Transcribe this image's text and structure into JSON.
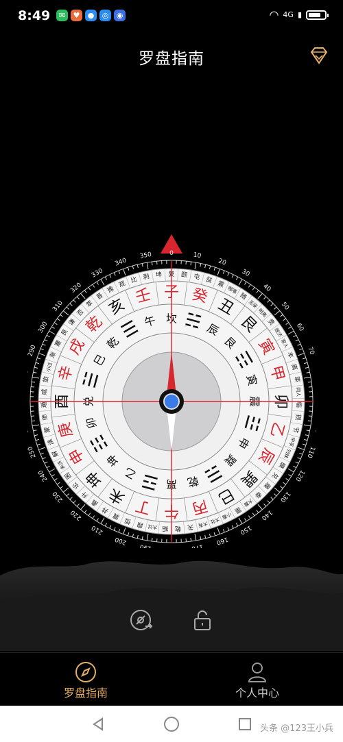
{
  "status": {
    "time": "8:49",
    "network": "4G"
  },
  "header": {
    "title": "罗盘指南"
  },
  "compass": {
    "heading_deg": 0,
    "degree_labels": [
      "0",
      "10",
      "20",
      "30",
      "40",
      "50",
      "60",
      "70",
      "80",
      "90",
      "100",
      "110",
      "120",
      "130",
      "140",
      "150",
      "160",
      "170",
      "180",
      "190",
      "200",
      "210",
      "220",
      "230",
      "240",
      "250",
      "260",
      "270",
      "280",
      "290",
      "300",
      "310",
      "320",
      "330",
      "340",
      "350"
    ],
    "mountains": [
      "子",
      "癸",
      "丑",
      "艮",
      "寅",
      "甲",
      "卯",
      "乙",
      "辰",
      "巽",
      "巳",
      "丙",
      "午",
      "丁",
      "未",
      "坤",
      "申",
      "庚",
      "酉",
      "辛",
      "戌",
      "乾",
      "亥",
      "壬"
    ],
    "mountain_red": [
      "子",
      "癸",
      "寅",
      "甲",
      "乙",
      "辰",
      "丙",
      "午",
      "丁",
      "申",
      "庚",
      "辛",
      "戌",
      "乾",
      "壬"
    ],
    "inner_ring": [
      "坎",
      "☵",
      "辰",
      "艮",
      "☶",
      "寅",
      "震",
      "☳",
      "申",
      "巽",
      "☴",
      "乾",
      "离",
      "☲",
      "乙",
      "坤",
      "☷",
      "卯",
      "兑",
      "☱",
      "巳",
      "乾",
      "☰",
      "午"
    ],
    "hexagrams": [
      "复",
      "颐",
      "屯",
      "益",
      "震",
      "噬嗑",
      "随",
      "无妄",
      "明夷",
      "贲",
      "既济",
      "家人",
      "丰",
      "离",
      "革",
      "同人",
      "临",
      "损",
      "节",
      "中孚",
      "归妹",
      "睽",
      "兑",
      "履",
      "泰",
      "大畜",
      "需",
      "小畜",
      "大壮",
      "大有",
      "夬",
      "乾",
      "姤",
      "大过",
      "鼎",
      "恒",
      "巽",
      "井",
      "蛊",
      "升",
      "讼",
      "困",
      "未济",
      "解",
      "涣",
      "蒙",
      "师",
      "遁",
      "咸",
      "旅",
      "小过",
      "渐",
      "蹇",
      "艮",
      "谦",
      "否",
      "萃",
      "晋",
      "豫",
      "观",
      "比",
      "剥",
      "坤"
    ],
    "accent_red": "#d7262e"
  },
  "tools": {
    "calibrate_icon": "compass-calibrate-icon",
    "lock_icon": "unlock-icon"
  },
  "nav": {
    "items": [
      {
        "label": "罗盘指南",
        "active": true
      },
      {
        "label": "个人中心",
        "active": false
      }
    ],
    "active_color": "#e7b165"
  },
  "watermark": "头条 @123王小兵"
}
